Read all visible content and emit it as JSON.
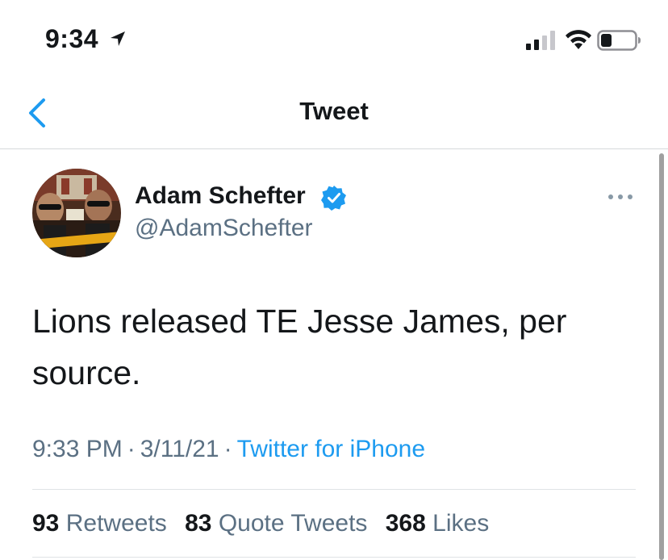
{
  "status_bar": {
    "time": "9:34",
    "icons": [
      "location-arrow-icon",
      "cellular-signal-icon",
      "wifi-icon",
      "battery-icon"
    ]
  },
  "nav": {
    "title": "Tweet",
    "back_icon": "chevron-left-icon"
  },
  "colors": {
    "accent": "#1d9bf0",
    "secondary_text": "#5b7083",
    "primary_text": "#14171a",
    "divider": "#dfe3e6"
  },
  "tweet": {
    "author_name": "Adam Schefter",
    "author_handle": "@AdamSchefter",
    "verified_icon": "verified-badge-icon",
    "more_icon": "more-horizontal-icon",
    "text": "Lions released TE Jesse James, per source.",
    "time": "9:33 PM",
    "date": "3/11/21",
    "separator": "·",
    "source": "Twitter for iPhone"
  },
  "stats": [
    {
      "value": "93",
      "label": "Retweets"
    },
    {
      "value": "83",
      "label": "Quote Tweets"
    },
    {
      "value": "368",
      "label": "Likes"
    }
  ]
}
